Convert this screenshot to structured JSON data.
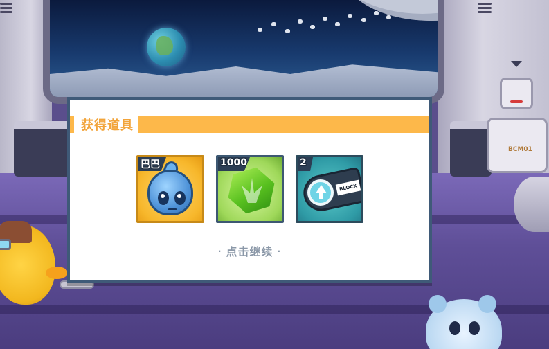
{
  "dialog": {
    "title": "获得道具",
    "continue_text": "点击继续",
    "continue_dot": "·"
  },
  "rewards": [
    {
      "count": "巴巴",
      "icon": "baba-pet-icon",
      "frame_color": "#f7b72b"
    },
    {
      "count": "1000",
      "icon": "green-gem-icon",
      "frame_color": "#9fd85a"
    },
    {
      "count": "2",
      "icon": "block-ticket-icon",
      "frame_color": "#2f9ba6",
      "ticket_text": "BLOCK"
    }
  ],
  "scene": {
    "machine_label": "BCM01"
  },
  "colors": {
    "accent": "#fdb84a",
    "title_text": "#f2a43a",
    "dialog_border": "#3f5a78",
    "continue_text": "#8b98a8"
  }
}
